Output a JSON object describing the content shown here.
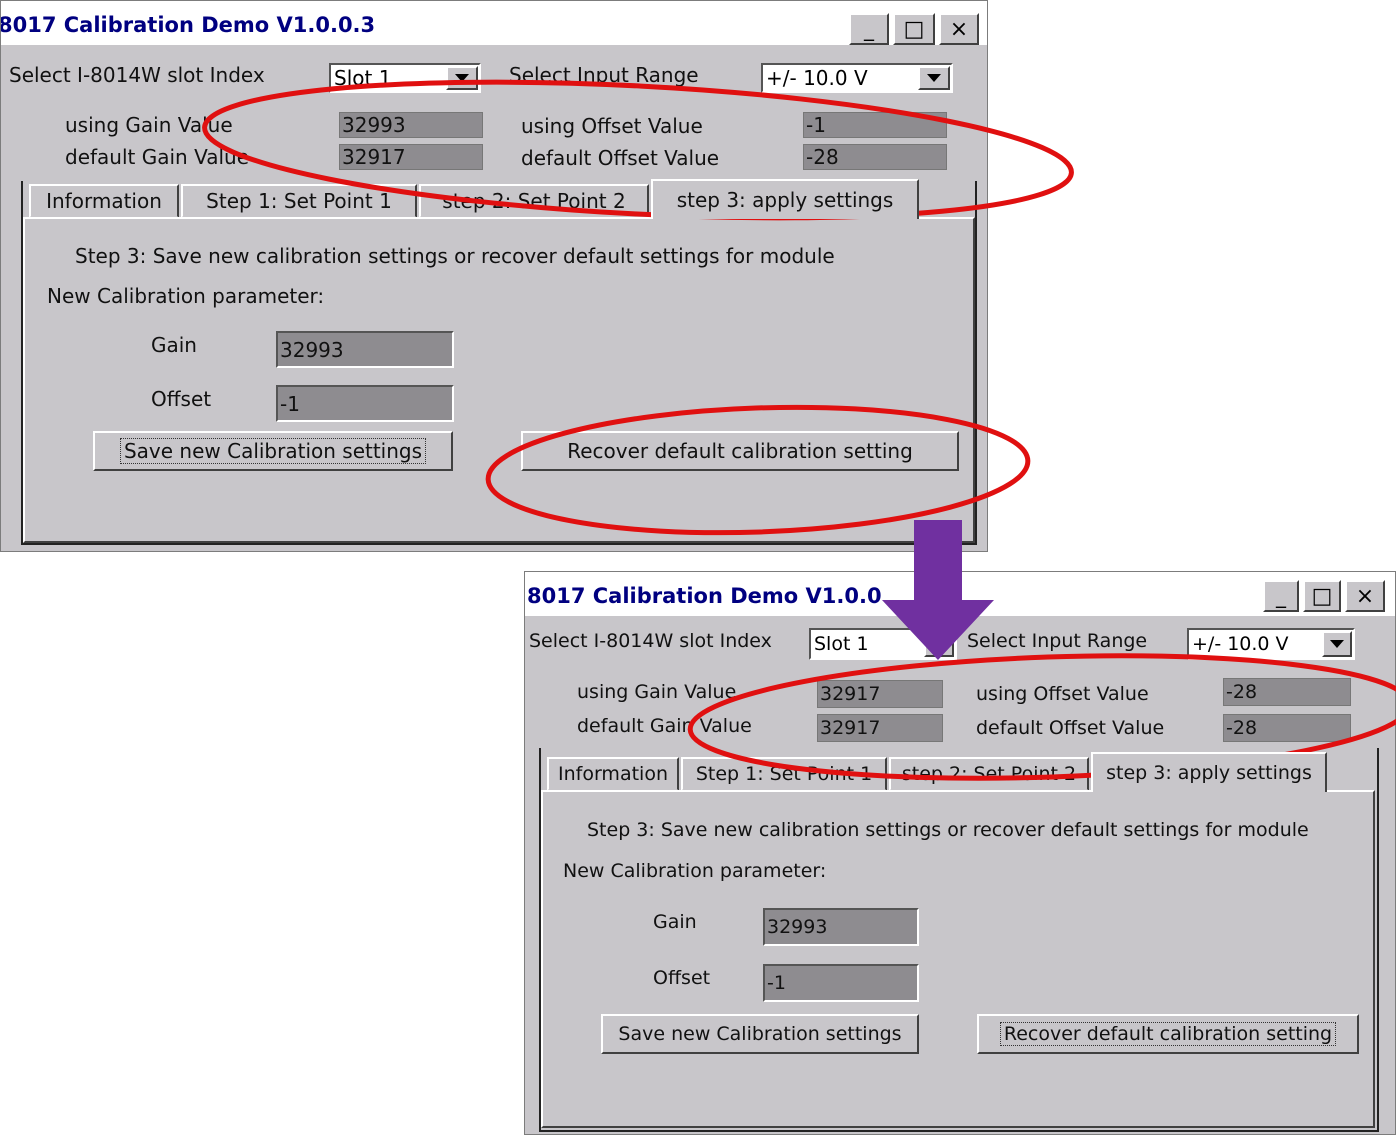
{
  "window_top": {
    "title": "8017 Calibration Demo V1.0.0.3",
    "minimize": "_",
    "maximize": "□",
    "close": "×",
    "slot_label": "Select I-8014W slot Index",
    "slot_value": "Slot 1",
    "range_label": "Select Input Range",
    "range_value": "+/- 10.0 V",
    "using_gain_label": "using Gain Value",
    "using_gain_value": "32993",
    "default_gain_label": "default Gain Value",
    "default_gain_value": "32917",
    "using_offset_label": "using Offset Value",
    "using_offset_value": "-1",
    "default_offset_label": "default Offset Value",
    "default_offset_value": "-28",
    "tabs": [
      "Information",
      "Step 1: Set Point 1",
      "step 2: Set Point 2",
      "step 3: apply settings"
    ],
    "step_text": "Step 3: Save new calibration settings or recover default settings for module",
    "param_label": "New Calibration parameter:",
    "gain_label": "Gain",
    "gain_value": "32993",
    "offset_label": "Offset",
    "offset_value": "-1",
    "save_button": "Save new Calibration settings",
    "recover_button": "Recover default calibration setting"
  },
  "window_bottom": {
    "title": "8017 Calibration Demo V1.0.0",
    "minimize": "_",
    "maximize": "□",
    "close": "×",
    "slot_label": "Select I-8014W slot Index",
    "slot_value": "Slot 1",
    "range_label": "Select Input Range",
    "range_value": "+/- 10.0 V",
    "using_gain_label": "using Gain Value",
    "using_gain_value": "32917",
    "default_gain_label": "default Gain Value",
    "default_gain_value": "32917",
    "using_offset_label": "using Offset Value",
    "using_offset_value": "-28",
    "default_offset_label": "default Offset Value",
    "default_offset_value": "-28",
    "tabs": [
      "Information",
      "Step 1: Set Point 1",
      "step 2: Set Point 2",
      "step 3: apply settings"
    ],
    "step_text": "Step 3: Save new calibration settings or recover default settings for module",
    "param_label": "New Calibration parameter:",
    "gain_label": "Gain",
    "gain_value": "32993",
    "offset_label": "Offset",
    "offset_value": "-1",
    "save_button": "Save new Calibration settings",
    "recover_button": "Recover default calibration setting"
  },
  "annotations": {
    "highlight_color": "#e01010",
    "arrow_color": "#7030a0"
  }
}
